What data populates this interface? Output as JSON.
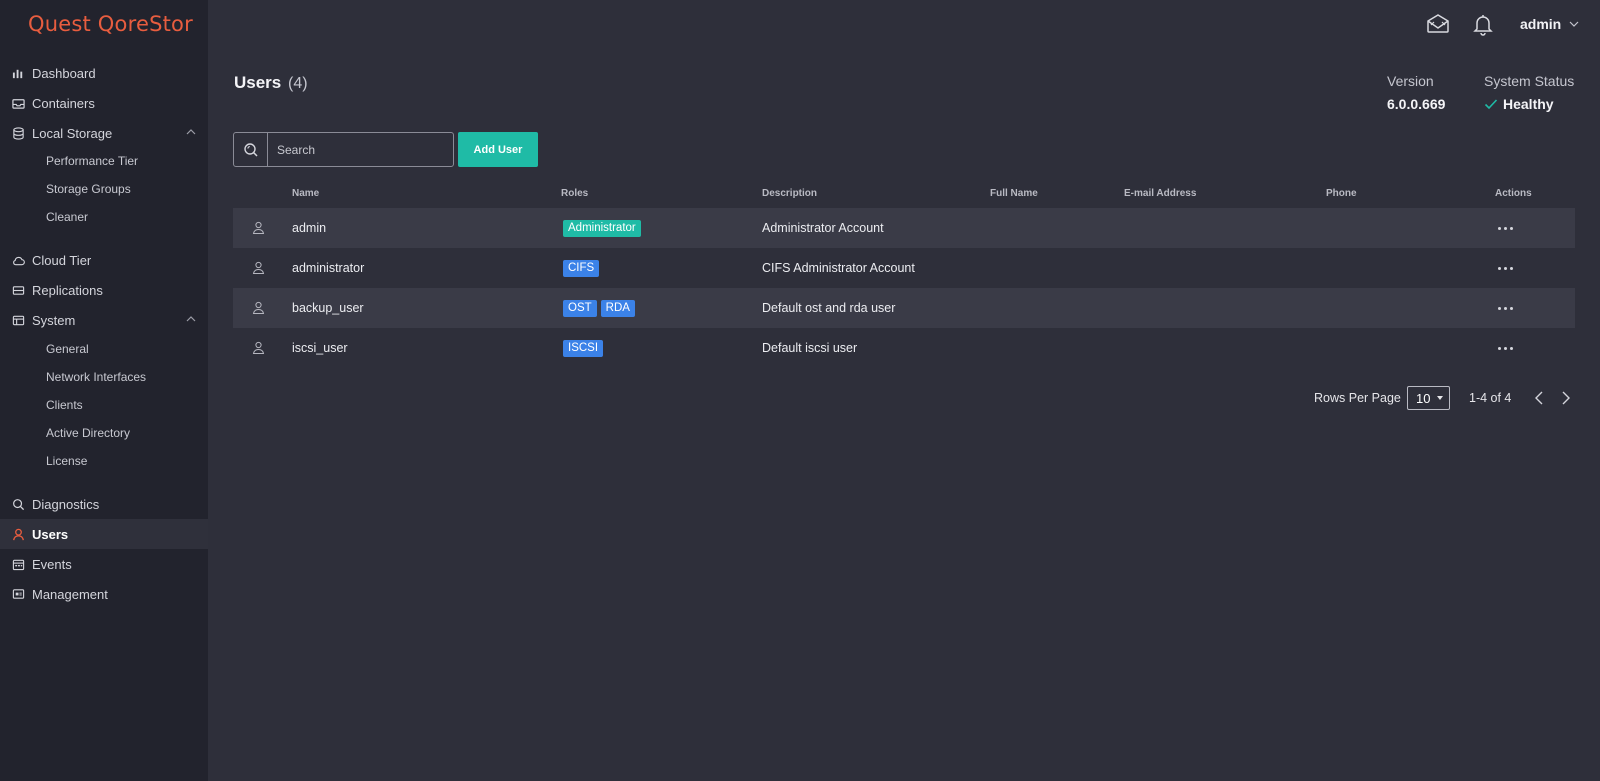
{
  "app": {
    "logo": "Quest QoreStor"
  },
  "header": {
    "user": "admin",
    "icons": [
      "messages-icon",
      "bell-icon",
      "chevron-down-icon"
    ]
  },
  "sidebar": {
    "items": [
      {
        "label": "Dashboard",
        "icon": "bar-chart-icon"
      },
      {
        "label": "Containers",
        "icon": "inbox-icon"
      },
      {
        "label": "Local Storage",
        "icon": "database-icon",
        "expanded": true,
        "children": [
          "Performance Tier",
          "Storage Groups",
          "Cleaner"
        ]
      },
      {
        "label": "Cloud Tier",
        "icon": "cloud-icon"
      },
      {
        "label": "Replications",
        "icon": "drive-icon"
      },
      {
        "label": "System",
        "icon": "window-icon",
        "expanded": true,
        "children": [
          "General",
          "Network Interfaces",
          "Clients",
          "Active Directory",
          "License"
        ]
      },
      {
        "label": "Diagnostics",
        "icon": "magnifier-icon"
      },
      {
        "label": "Users",
        "icon": "user-icon",
        "active": true
      },
      {
        "label": "Events",
        "icon": "calendar-icon"
      },
      {
        "label": "Management",
        "icon": "monitor-icon"
      }
    ]
  },
  "main": {
    "title": "Users",
    "count": "(4)",
    "version_label": "Version",
    "version_value": "6.0.0.669",
    "status_label": "System Status",
    "status_value": "Healthy",
    "search_placeholder": "Search",
    "add_button": "Add User"
  },
  "table": {
    "columns": [
      "Name",
      "Roles",
      "Description",
      "Full Name",
      "E-mail Address",
      "Phone",
      "Actions"
    ],
    "rows": [
      {
        "name": "admin",
        "roles": [
          "Administrator"
        ],
        "description": "Administrator Account"
      },
      {
        "name": "administrator",
        "roles": [
          "CIFS"
        ],
        "description": "CIFS Administrator Account"
      },
      {
        "name": "backup_user",
        "roles": [
          "OST",
          "RDA"
        ],
        "description": "Default ost and rda user"
      },
      {
        "name": "iscsi_user",
        "roles": [
          "ISCSI"
        ],
        "description": "Default iscsi user"
      }
    ]
  },
  "pagination": {
    "rows_per_page_label": "Rows Per Page",
    "rows_per_page": "10",
    "range": "1-4 of 4"
  },
  "colors": {
    "accent": "#1fbba6",
    "brand": "#e85d3f",
    "role_admin": "#1fbba6",
    "role_other": "#3b82e8",
    "healthy": "#1fbba6"
  }
}
